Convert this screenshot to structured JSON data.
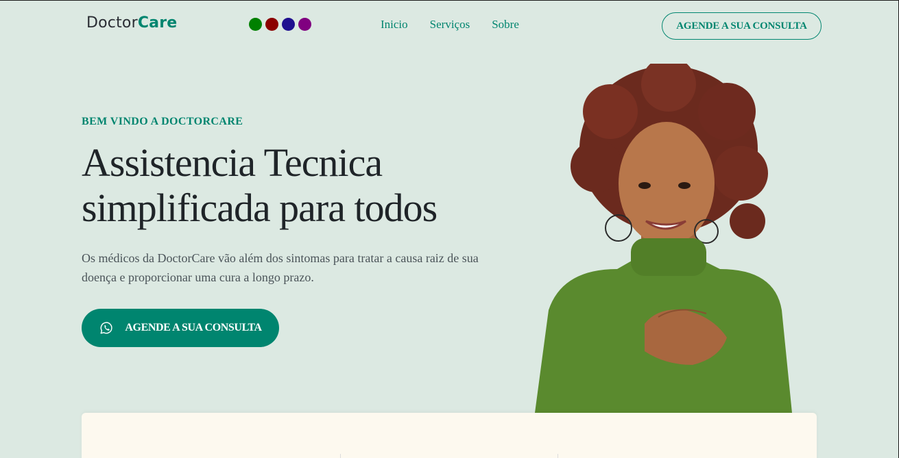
{
  "header": {
    "logo_part1": "Doctor",
    "logo_part2": "Care",
    "color_swatches": [
      "#008000",
      "#8b0000",
      "#1f0f8f",
      "#800080"
    ],
    "nav": [
      {
        "label": "Inicio"
      },
      {
        "label": "Serviços"
      },
      {
        "label": "Sobre"
      }
    ],
    "cta_label": "AGENDE A SUA CONSULTA"
  },
  "hero": {
    "eyebrow": "BEM VINDO A DOCTORCARE",
    "title_line1": "Assistencia Tecnica",
    "title_line2": "simplificada para todos",
    "description": "Os médicos da DoctorCare vão além dos sintomas para tratar a causa raiz de sua doença e proporcionar uma cura a longo prazo.",
    "cta_label": "AGENDE A SUA CONSULTA",
    "cta_icon": "whatsapp-icon",
    "image": "woman-in-green-turtleneck-portrait"
  },
  "colors": {
    "accent": "#00856f",
    "background": "#dce9e2",
    "card": "#fdf9ef",
    "text_dark": "#1f2428"
  }
}
